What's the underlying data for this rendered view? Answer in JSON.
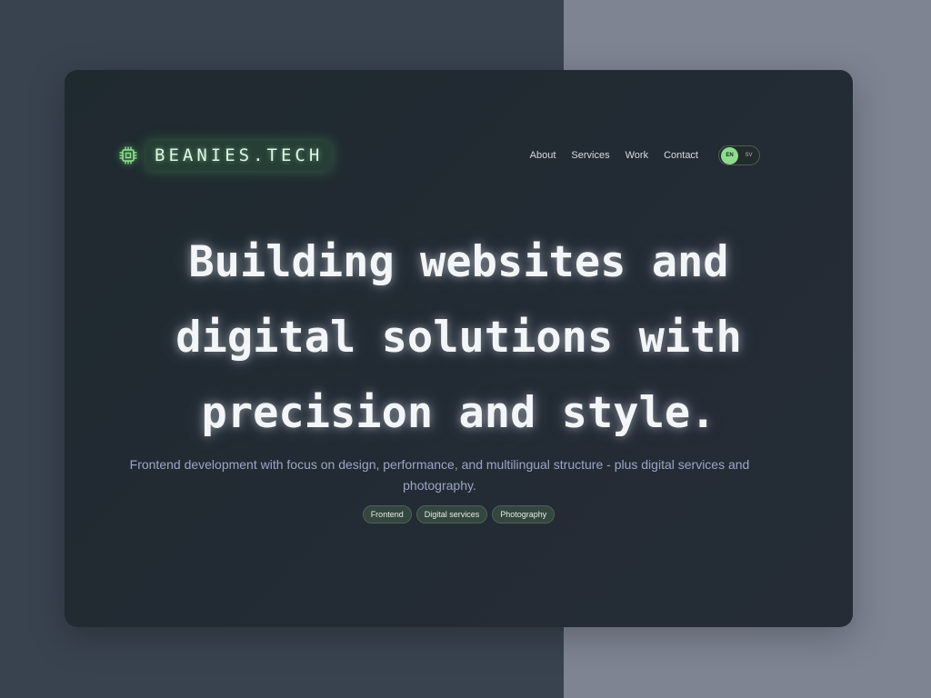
{
  "brand": {
    "name": "BEANIES.TECH",
    "icon": "chip-icon",
    "accent": "#8fdc8f"
  },
  "nav": {
    "items": [
      "About",
      "Services",
      "Work",
      "Contact"
    ]
  },
  "lang": {
    "active": "EN",
    "other": "SV"
  },
  "hero": {
    "headline_lines": [
      "Building websites and",
      "digital solutions with",
      "precision and style."
    ],
    "subtitle": "Frontend development with focus on design, performance, and multilingual structure - plus digital services and photography."
  },
  "tags": [
    "Frontend",
    "Digital services",
    "Photography"
  ],
  "colors": {
    "background_left": "#39434f",
    "background_right": "#7e8492",
    "card": "#232b34",
    "subtitle": "#9ba6c8"
  }
}
